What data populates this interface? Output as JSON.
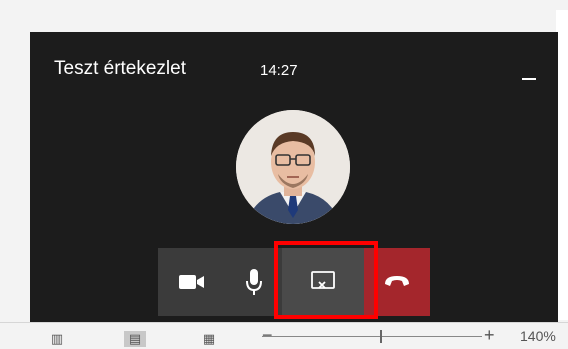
{
  "meeting": {
    "title": "Teszt értekezlet",
    "time": "14:27"
  },
  "window_controls": {
    "minimize_icon": "minimize-icon"
  },
  "controls": {
    "video_icon": "video-camera-icon",
    "mic_icon": "microphone-icon",
    "share_icon": "stop-sharing-icon",
    "hangup_icon": "hang-up-icon",
    "hangup_color": "#a4262c",
    "button_color": "#3b3b3b"
  },
  "highlight_color": "#ff0000",
  "status_bar": {
    "zoom_minus": "−",
    "zoom_plus": "+",
    "zoom_level": "140%",
    "zoom_fraction": 0.54
  }
}
